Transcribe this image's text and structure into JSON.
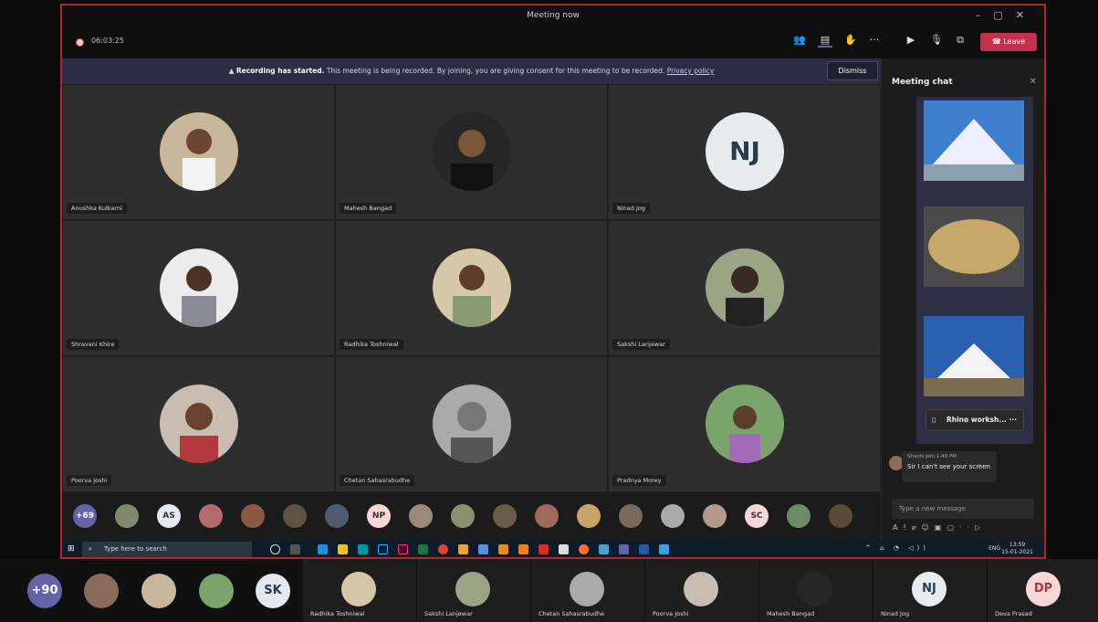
{
  "window": {
    "title": "Meeting now"
  },
  "toolbar": {
    "timer": "06:03:25",
    "leave_label": "Leave"
  },
  "banner": {
    "bold": "Recording has started.",
    "text": "This meeting is being recorded. By joining, you are giving consent for this meeting to be recorded.",
    "link": "Privacy policy",
    "dismiss": "Dismiss"
  },
  "participants": [
    {
      "name": "Anushka Kulkarni"
    },
    {
      "name": "Mahesh Bangad"
    },
    {
      "name": "Ninad Jog",
      "initials": "NJ"
    },
    {
      "name": "Shravani Khire"
    },
    {
      "name": "Radhika Toshniwal"
    },
    {
      "name": "Sakshi Lanjewar"
    },
    {
      "name": "Poorva Joshi"
    },
    {
      "name": "Chetan Sahasrabudhe"
    },
    {
      "name": "Pradnya Morey"
    }
  ],
  "strip": {
    "count": "+69",
    "initials": [
      "AS",
      "NP",
      "SC"
    ]
  },
  "chat": {
    "title": "Meeting chat",
    "file_name": "Rhino worksh...",
    "message": {
      "author": "Shachi Jain",
      "time": "1:49 PM",
      "text": "Sir I can't see your screen"
    },
    "compose_placeholder": "Type a new message"
  },
  "taskbar": {
    "search_placeholder": "Type here to search",
    "lang": "ENG",
    "time": "13:59",
    "date": "15-01-2021"
  },
  "bottom": {
    "count": "+90",
    "avatars_initials": [
      "SK"
    ],
    "tiles": [
      {
        "name": "Radhika Toshniwal"
      },
      {
        "name": "Sakshi Lanjewar"
      },
      {
        "name": "Chetan Sahasrabudhe"
      },
      {
        "name": "Poorva Joshi"
      },
      {
        "name": "Mahesh Bangad"
      },
      {
        "name": "Ninad Jog",
        "initials": "NJ"
      },
      {
        "name": "Deva Prasad",
        "initials": "DP"
      }
    ]
  },
  "colors": {
    "leave": "#c4314b",
    "banner": "#2d2c45",
    "accent": "#6264a7",
    "border": "#b3262f"
  }
}
